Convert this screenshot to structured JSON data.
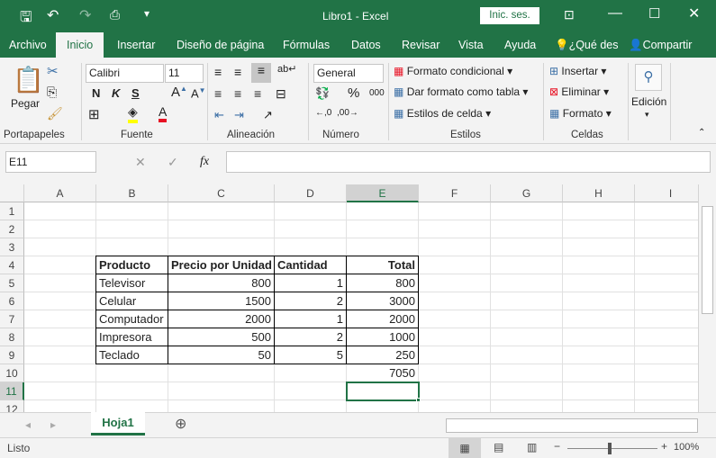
{
  "title": {
    "doc": "Libro1 - Excel",
    "signin": "Inic. ses."
  },
  "tabs": [
    "Archivo",
    "Inicio",
    "Insertar",
    "Diseño de página",
    "Fórmulas",
    "Datos",
    "Revisar",
    "Vista",
    "Ayuda",
    "¿Qué des",
    "Compartir"
  ],
  "ribbon": {
    "paste": "Pegar",
    "font": "Calibri",
    "size": "11",
    "bold": "N",
    "italic": "K",
    "underline": "S",
    "numfmt": "General",
    "cond": "Formato condicional",
    "astable": "Dar formato como tabla",
    "cellstyles": "Estilos de celda",
    "insert": "Insertar",
    "delete": "Eliminar",
    "format": "Formato",
    "edit": "Edición",
    "groups": [
      "Portapapeles",
      "Fuente",
      "Alineación",
      "Número",
      "Estilos",
      "Celdas"
    ]
  },
  "formula": {
    "namebox": "E11",
    "fx": "fx",
    "value": ""
  },
  "columns": [
    "A",
    "B",
    "C",
    "D",
    "E",
    "F",
    "G",
    "H",
    "I"
  ],
  "rows": [
    "1",
    "2",
    "3",
    "4",
    "5",
    "6",
    "7",
    "8",
    "9",
    "10",
    "11",
    "12"
  ],
  "table": {
    "headers": [
      "Producto",
      "Precio por Unidad",
      "Cantidad",
      "Total"
    ],
    "rows": [
      [
        "Televisor",
        "800",
        "1",
        "800"
      ],
      [
        "Celular",
        "1500",
        "2",
        "3000"
      ],
      [
        "Computador",
        "2000",
        "1",
        "2000"
      ],
      [
        "Impresora",
        "500",
        "2",
        "1000"
      ],
      [
        "Teclado",
        "50",
        "5",
        "250"
      ]
    ],
    "grand_total": "7050"
  },
  "selected_cell": "E11",
  "sheet": {
    "tab": "Hoja1"
  },
  "status": {
    "text": "Listo",
    "zoom": "100%"
  },
  "colors": {
    "accent": "#217346"
  }
}
